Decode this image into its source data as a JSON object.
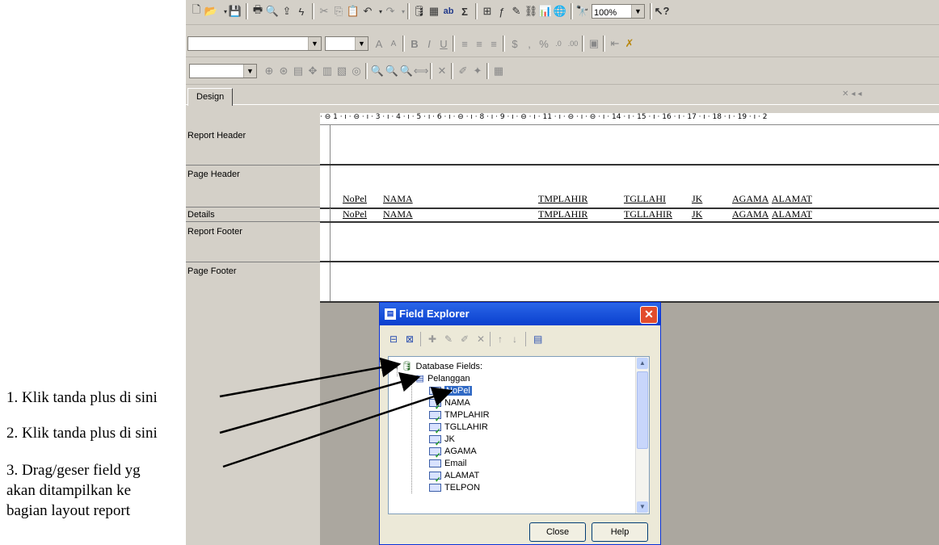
{
  "toolbar": {
    "zoom_value": "100%"
  },
  "tabs": {
    "design": "Design"
  },
  "sections": {
    "report_header": "Report Header",
    "page_header": "Page Header",
    "details": "Details",
    "report_footer": "Report Footer",
    "page_footer": "Page Footer"
  },
  "ruler": "· ⊖ 1 · ı · ⊖ · ı · 3 · ı · 4 · ı · 5 · ı · 6 · ı · ⊖ · ı · 8 · ı · 9 · ı · ⊖ · ı · 11 · ı · ⊖ · ı · ⊖ · ı · 14 · ı · 15 · ı · 16 · ı · 17 · ı · 18 · ı · 19 · ı · 2",
  "page_header_fields": [
    "NoPel",
    "NAMA",
    "TMPLAHIR",
    "TGLLAHI",
    "JK",
    "AGAMA",
    "ALAMAT"
  ],
  "detail_fields": [
    "NoPel",
    "NAMA",
    "TMPLAHIR",
    "TGLLAHIR",
    "JK",
    "AGAMA",
    "ALAMAT"
  ],
  "field_explorer": {
    "title": "Field Explorer",
    "root": "Database Fields:",
    "table": "Pelanggan",
    "fields": [
      "NoPel",
      "NAMA",
      "TMPLAHIR",
      "TGLLAHIR",
      "JK",
      "AGAMA",
      "Email",
      "ALAMAT",
      "TELPON"
    ],
    "close_label": "Close",
    "help_label": "Help"
  },
  "annotations": {
    "note1": "1. Klik tanda plus di sini",
    "note2": "2. Klik tanda plus di sini",
    "note3_line1": "3. Drag/geser field yg",
    "note3_line2": "akan ditampilkan ke",
    "note3_line3": "bagian layout report"
  },
  "colors": {
    "titlebar": "#0a3fce",
    "selection": "#316ac5",
    "canvas_gray": "#aba79f"
  }
}
